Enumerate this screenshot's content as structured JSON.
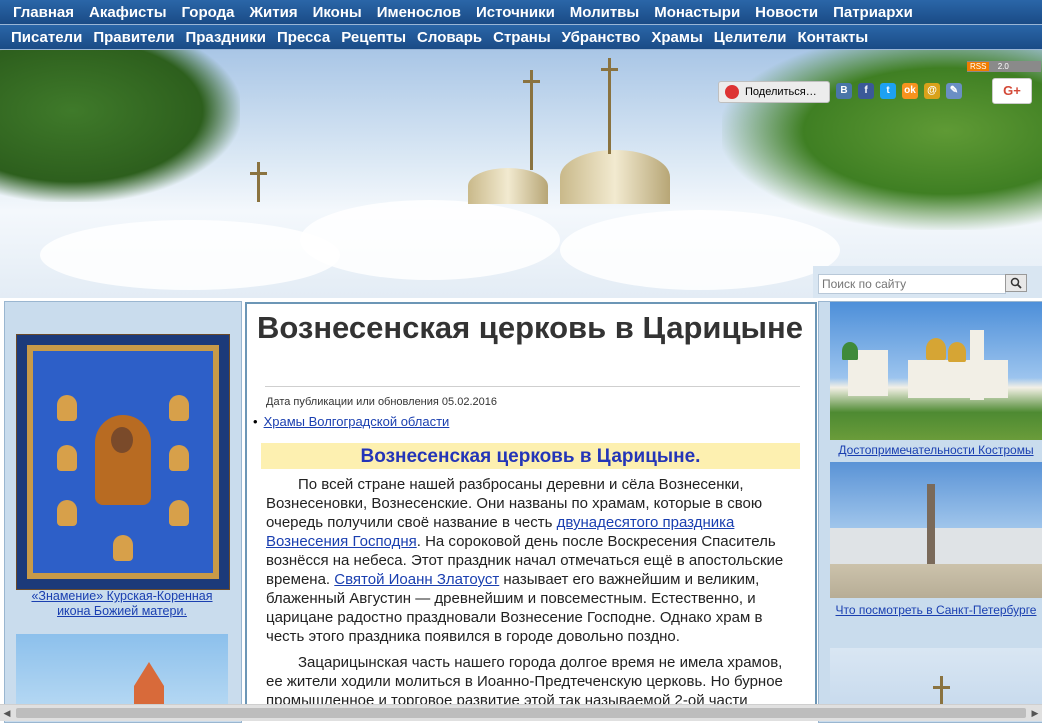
{
  "nav": {
    "row1": [
      "Главная",
      "Акафисты",
      "Города",
      "Жития",
      "Иконы",
      "Именослов",
      "Источники",
      "Молитвы",
      "Монастыри",
      "Новости",
      "Патриархи"
    ],
    "row2": [
      "Писатели",
      "Правители",
      "Праздники",
      "Пресса",
      "Рецепты",
      "Словарь",
      "Страны",
      "Убранство",
      "Храмы",
      "Целители",
      "Контакты"
    ]
  },
  "header": {
    "share_label": "Поделиться…",
    "rss_label": "RSS",
    "rss_version": "2.0",
    "gplus_label": "G+",
    "social_icons": [
      "В",
      "f",
      "t",
      "ok",
      "@",
      "✎"
    ]
  },
  "search": {
    "placeholder": "Поиск по сайту"
  },
  "left_sidebar": {
    "icon_caption": "«Знамение» Курская-Коренная икона Божией матери."
  },
  "right_sidebar": {
    "captions": [
      "Достопримечательности Костромы",
      "Что посмотреть в Санкт-Петербурге"
    ]
  },
  "article": {
    "title": "Вознесенская церковь в Царицыне",
    "pubdate": "Дата публикации или обновления 05.02.2016",
    "category_link": "Храмы Волгоградской области",
    "highlight": "Вознесенская церковь в Царицыне.",
    "p1": {
      "t1": "По всей стране нашей разбросаны деревни и сёла Вознесенки, Вознесеновки, Вознесенские. Они названы по храмам, которые в свою очередь получили своё название в честь ",
      "l1": "двунадесятого праздника Вознесения Господня",
      "t2": ". На сороковой день после Воскресения Спаситель вознёсся на небеса. Этот праздник начал отмечаться ещё в апостольские времена. ",
      "l2": "Святой Иоанн Златоуст",
      "t3": " называет его важнейшим и великим, блаженный Августин — древнейшим и повсеместным. Естественно, и царицане радостно праздновали Вознесение Господне. Однако храм в честь этого праздника появился в городе довольно поздно."
    },
    "p2": "Зацарицынская часть нашего города долгое время не имела храмов, ее жители ходили молиться в Иоанно-Предтеченскую церковь. Но бурное промышленное и торговое развитие этой так называемой 2-ой части"
  }
}
